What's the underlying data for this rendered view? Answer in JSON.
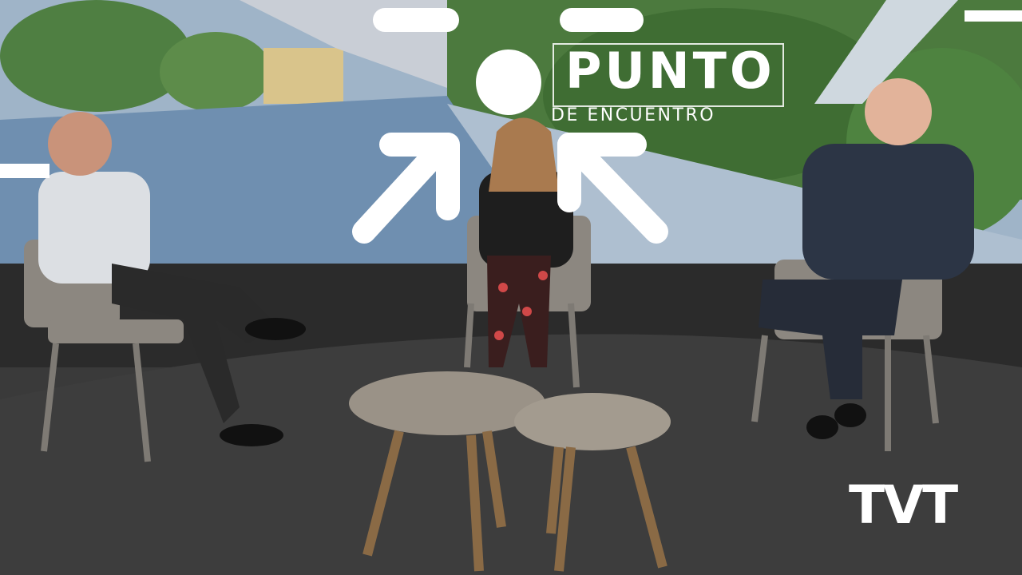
{
  "show": {
    "title": "PUNTO",
    "subtitle": "DE ENCUENTRO"
  },
  "broadcaster": {
    "logo": "TVT"
  },
  "scene": {
    "participants": [
      "host-man-left",
      "woman-center",
      "man-right"
    ],
    "colors": {
      "sky": "#9fb4c8",
      "floor": "#3d3d3d",
      "wall": "#2b2b2b",
      "promenade": "#6f8fb0",
      "foliage": "#4c7a3e",
      "chair": "#8c8780",
      "table": "#9a9287"
    }
  }
}
